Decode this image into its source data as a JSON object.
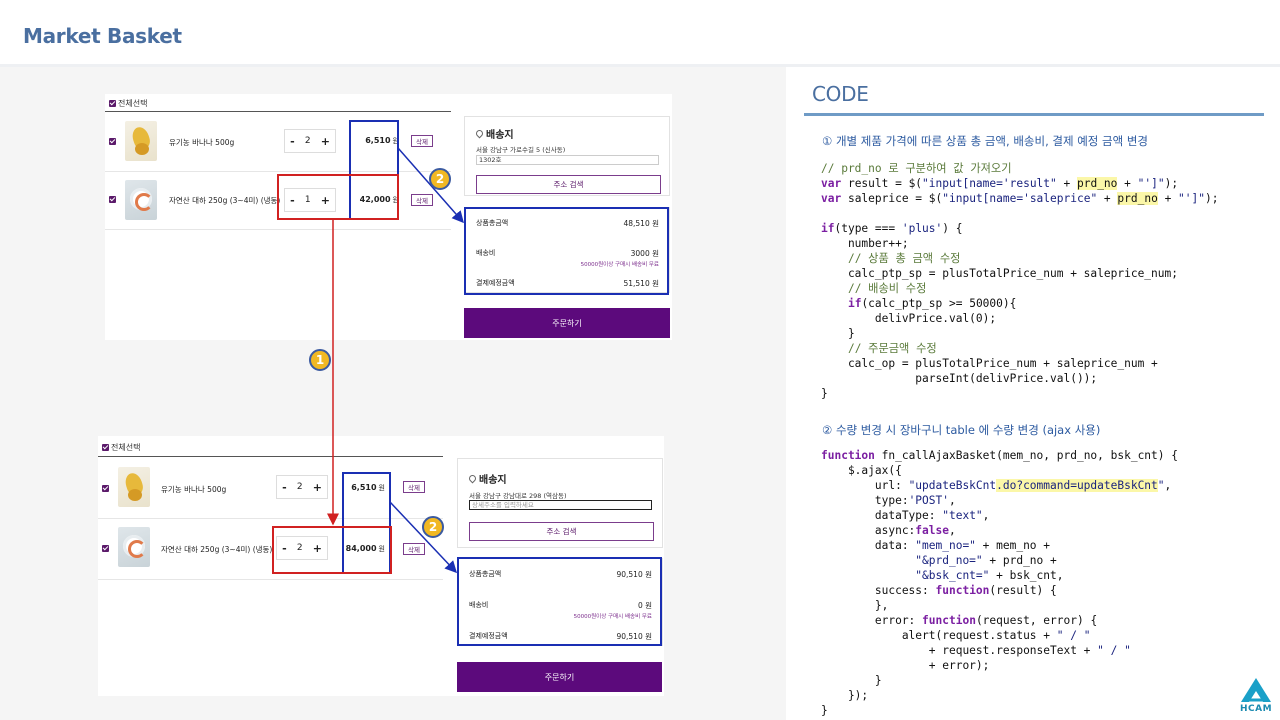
{
  "page": {
    "title": "Market Basket"
  },
  "colors": {
    "title": "#4a6fa0",
    "accent_purple": "#5c0a7c",
    "highlight_blue": "#1a2fb3",
    "highlight_red": "#d12121",
    "badge": "#f1b823"
  },
  "cart_top": {
    "select_all": "전체선택",
    "items": [
      {
        "name": "유기농 바나나 500g",
        "qty": "2",
        "price": "6,510",
        "unit": "원",
        "delete": "삭제",
        "thumb": "banana-image"
      },
      {
        "name": "자연산 대하 250g (3~4미) (냉동)",
        "qty": "1",
        "price": "42,000",
        "unit": "원",
        "delete": "삭제",
        "thumb": "shrimp-image"
      }
    ],
    "stepper_minus": "-",
    "stepper_plus": "+",
    "delivery": {
      "heading": "배송지",
      "address": "서울 강남구 가로수길 5 (신사동)",
      "detail_value": "1302호",
      "search_button": "주소 검색"
    },
    "summary": {
      "product_total_label": "상품총금액",
      "product_total": "48,510 원",
      "shipping_label": "배송비",
      "shipping": "3000 원",
      "shipping_note": "50000원이상 구매시 배송비 무료",
      "pay_label": "결제예정금액",
      "pay_total": "51,510 원"
    },
    "order_button": "주문하기"
  },
  "cart_bottom": {
    "select_all": "전체선택",
    "items": [
      {
        "name": "유기농 바나나 500g",
        "qty": "2",
        "price": "6,510",
        "unit": "원",
        "delete": "삭제",
        "thumb": "banana-image"
      },
      {
        "name": "자연산 대하 250g (3~4미) (냉동)",
        "qty": "2",
        "price": "84,000",
        "unit": "원",
        "delete": "삭제",
        "thumb": "shrimp-image"
      }
    ],
    "stepper_minus": "-",
    "stepper_plus": "+",
    "delivery": {
      "heading": "배송지",
      "address": "서울 강남구 강남대로 298 (역삼동)",
      "detail_placeholder": "상세주소를 입력하세요",
      "search_button": "주소 검색"
    },
    "summary": {
      "product_total_label": "상품총금액",
      "product_total": "90,510 원",
      "shipping_label": "배송비",
      "shipping": "0 원",
      "shipping_note": "50000원이상 구매시 배송비 무료",
      "pay_label": "결제예정금액",
      "pay_total": "90,510 원"
    },
    "order_button": "주문하기"
  },
  "annotations": {
    "badge_1": "1",
    "badge_2": "2"
  },
  "code": {
    "title": "CODE",
    "heading_1": "① 개별 제품 가격에 따른 상품 총 금액, 배송비, 결제 예정 금액 변경",
    "heading_2": "② 수량 변경 시 장바구니 table 에 수량 변경 (ajax 사용)"
  },
  "logo": {
    "text": "HCAM"
  }
}
